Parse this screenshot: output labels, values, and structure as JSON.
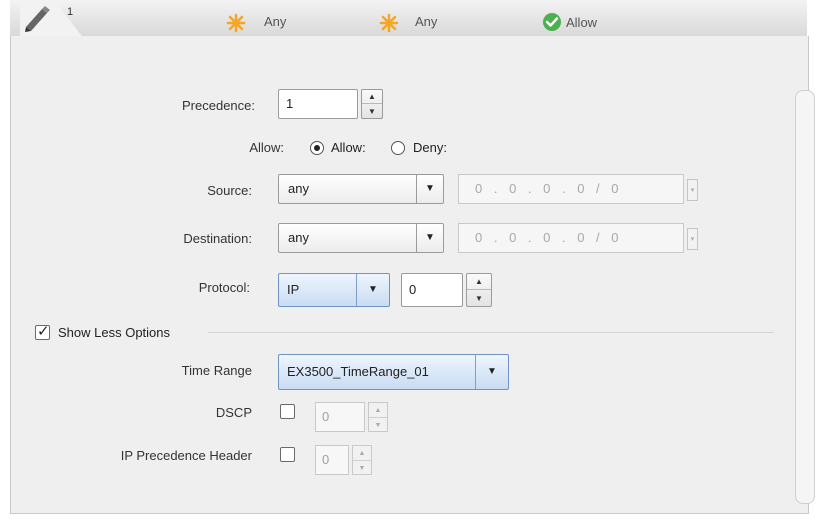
{
  "summary": {
    "rule_number": "1",
    "source": "Any",
    "destination": "Any",
    "action": "Allow"
  },
  "form": {
    "precedence_label": "Precedence:",
    "precedence_value": "1",
    "allow_label": "Allow:",
    "allow_option": "Allow:",
    "deny_option": "Deny:",
    "source_label": "Source:",
    "source_value": "any",
    "source_ip": "0 . 0 . 0 . 0 / 0",
    "destination_label": "Destination:",
    "destination_value": "any",
    "destination_ip": "0 . 0 . 0 . 0 / 0",
    "protocol_label": "Protocol:",
    "protocol_value": "IP",
    "protocol_number": "0",
    "show_less_label": "Show Less Options",
    "time_range_label": "Time Range",
    "time_range_value": "EX3500_TimeRange_01",
    "dscp_label": "DSCP",
    "dscp_value": "0",
    "ip_precedence_label": "IP Precedence Header",
    "ip_precedence_value": "0"
  },
  "icons": {
    "edit": "pencil-icon",
    "any": "sun-asterisk-icon",
    "allow": "green-check-circle-icon"
  },
  "colors": {
    "any_icon": "#f5a623",
    "allow_icon": "#4caf50",
    "time_range_select": "#c9dcf3"
  }
}
